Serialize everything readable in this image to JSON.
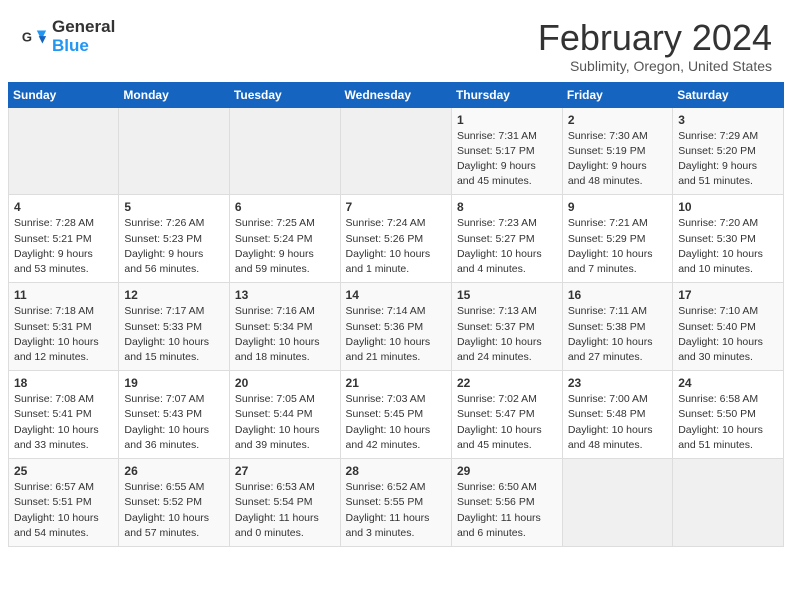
{
  "header": {
    "logo_general": "General",
    "logo_blue": "Blue",
    "title": "February 2024",
    "subtitle": "Sublimity, Oregon, United States"
  },
  "days_of_week": [
    "Sunday",
    "Monday",
    "Tuesday",
    "Wednesday",
    "Thursday",
    "Friday",
    "Saturday"
  ],
  "weeks": [
    [
      {
        "day": "",
        "info": ""
      },
      {
        "day": "",
        "info": ""
      },
      {
        "day": "",
        "info": ""
      },
      {
        "day": "",
        "info": ""
      },
      {
        "day": "1",
        "info": "Sunrise: 7:31 AM\nSunset: 5:17 PM\nDaylight: 9 hours\nand 45 minutes."
      },
      {
        "day": "2",
        "info": "Sunrise: 7:30 AM\nSunset: 5:19 PM\nDaylight: 9 hours\nand 48 minutes."
      },
      {
        "day": "3",
        "info": "Sunrise: 7:29 AM\nSunset: 5:20 PM\nDaylight: 9 hours\nand 51 minutes."
      }
    ],
    [
      {
        "day": "4",
        "info": "Sunrise: 7:28 AM\nSunset: 5:21 PM\nDaylight: 9 hours\nand 53 minutes."
      },
      {
        "day": "5",
        "info": "Sunrise: 7:26 AM\nSunset: 5:23 PM\nDaylight: 9 hours\nand 56 minutes."
      },
      {
        "day": "6",
        "info": "Sunrise: 7:25 AM\nSunset: 5:24 PM\nDaylight: 9 hours\nand 59 minutes."
      },
      {
        "day": "7",
        "info": "Sunrise: 7:24 AM\nSunset: 5:26 PM\nDaylight: 10 hours\nand 1 minute."
      },
      {
        "day": "8",
        "info": "Sunrise: 7:23 AM\nSunset: 5:27 PM\nDaylight: 10 hours\nand 4 minutes."
      },
      {
        "day": "9",
        "info": "Sunrise: 7:21 AM\nSunset: 5:29 PM\nDaylight: 10 hours\nand 7 minutes."
      },
      {
        "day": "10",
        "info": "Sunrise: 7:20 AM\nSunset: 5:30 PM\nDaylight: 10 hours\nand 10 minutes."
      }
    ],
    [
      {
        "day": "11",
        "info": "Sunrise: 7:18 AM\nSunset: 5:31 PM\nDaylight: 10 hours\nand 12 minutes."
      },
      {
        "day": "12",
        "info": "Sunrise: 7:17 AM\nSunset: 5:33 PM\nDaylight: 10 hours\nand 15 minutes."
      },
      {
        "day": "13",
        "info": "Sunrise: 7:16 AM\nSunset: 5:34 PM\nDaylight: 10 hours\nand 18 minutes."
      },
      {
        "day": "14",
        "info": "Sunrise: 7:14 AM\nSunset: 5:36 PM\nDaylight: 10 hours\nand 21 minutes."
      },
      {
        "day": "15",
        "info": "Sunrise: 7:13 AM\nSunset: 5:37 PM\nDaylight: 10 hours\nand 24 minutes."
      },
      {
        "day": "16",
        "info": "Sunrise: 7:11 AM\nSunset: 5:38 PM\nDaylight: 10 hours\nand 27 minutes."
      },
      {
        "day": "17",
        "info": "Sunrise: 7:10 AM\nSunset: 5:40 PM\nDaylight: 10 hours\nand 30 minutes."
      }
    ],
    [
      {
        "day": "18",
        "info": "Sunrise: 7:08 AM\nSunset: 5:41 PM\nDaylight: 10 hours\nand 33 minutes."
      },
      {
        "day": "19",
        "info": "Sunrise: 7:07 AM\nSunset: 5:43 PM\nDaylight: 10 hours\nand 36 minutes."
      },
      {
        "day": "20",
        "info": "Sunrise: 7:05 AM\nSunset: 5:44 PM\nDaylight: 10 hours\nand 39 minutes."
      },
      {
        "day": "21",
        "info": "Sunrise: 7:03 AM\nSunset: 5:45 PM\nDaylight: 10 hours\nand 42 minutes."
      },
      {
        "day": "22",
        "info": "Sunrise: 7:02 AM\nSunset: 5:47 PM\nDaylight: 10 hours\nand 45 minutes."
      },
      {
        "day": "23",
        "info": "Sunrise: 7:00 AM\nSunset: 5:48 PM\nDaylight: 10 hours\nand 48 minutes."
      },
      {
        "day": "24",
        "info": "Sunrise: 6:58 AM\nSunset: 5:50 PM\nDaylight: 10 hours\nand 51 minutes."
      }
    ],
    [
      {
        "day": "25",
        "info": "Sunrise: 6:57 AM\nSunset: 5:51 PM\nDaylight: 10 hours\nand 54 minutes."
      },
      {
        "day": "26",
        "info": "Sunrise: 6:55 AM\nSunset: 5:52 PM\nDaylight: 10 hours\nand 57 minutes."
      },
      {
        "day": "27",
        "info": "Sunrise: 6:53 AM\nSunset: 5:54 PM\nDaylight: 11 hours\nand 0 minutes."
      },
      {
        "day": "28",
        "info": "Sunrise: 6:52 AM\nSunset: 5:55 PM\nDaylight: 11 hours\nand 3 minutes."
      },
      {
        "day": "29",
        "info": "Sunrise: 6:50 AM\nSunset: 5:56 PM\nDaylight: 11 hours\nand 6 minutes."
      },
      {
        "day": "",
        "info": ""
      },
      {
        "day": "",
        "info": ""
      }
    ]
  ]
}
